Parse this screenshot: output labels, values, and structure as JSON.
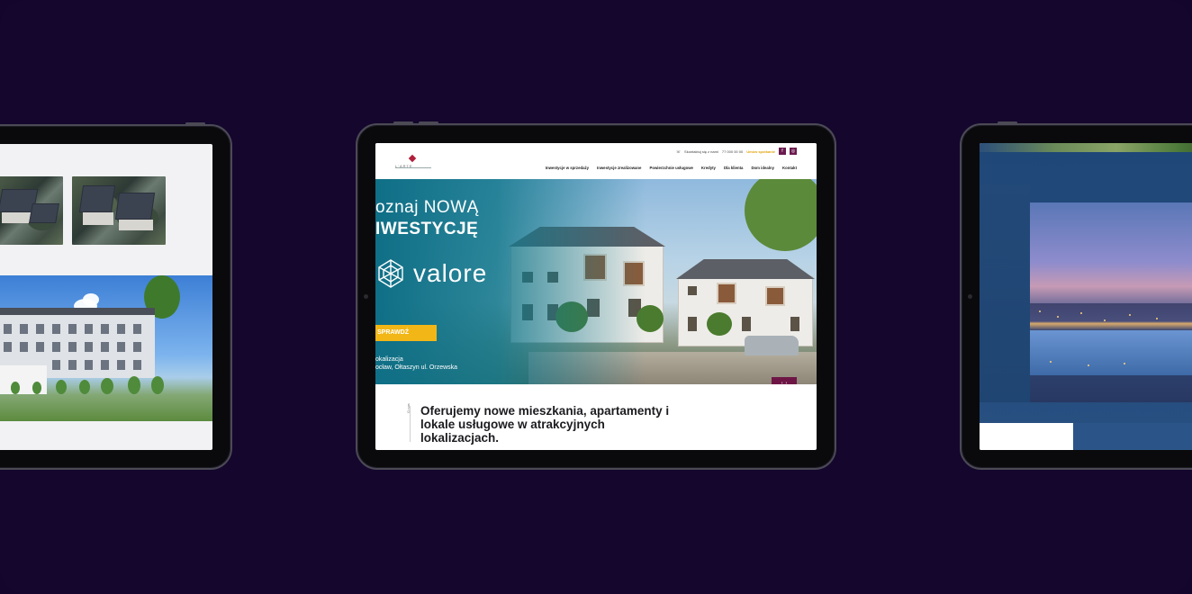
{
  "colors": {
    "background": "#14062d",
    "brand_magenta": "#6d1646",
    "cta_yellow": "#f2b616",
    "hero_teal": "#0f6f86"
  },
  "center_site": {
    "logo_text": "L'ARTE",
    "topbar": {
      "contact_text": "Skontaktuj się z nami",
      "phone": "77 000 00 00",
      "highlight": "Umów spotkanie"
    },
    "nav": [
      "Inwestycje w sprzedaży",
      "Inwestycje zrealizowane",
      "Powierzchnie usługowe",
      "Kredyty",
      "Dla klienta",
      "Dom idealny",
      "Kontakt"
    ],
    "hero": {
      "title_line1_prefix": "oznaj ",
      "title_line1_bold": "NOWĄ",
      "title_line2": "IWESTYCJĘ",
      "brand_name": "valore",
      "cta_label": "SPRAWDŹ",
      "location_line1": "okalizacja",
      "location_line2": "ocław, Ołtaszyn ul. Orzewska"
    },
    "section_label": "O nas",
    "lead": "Oferujemy nowe mieszkania, apartamenty i lokale usługowe w atrakcyjnych lokalizacjach."
  }
}
